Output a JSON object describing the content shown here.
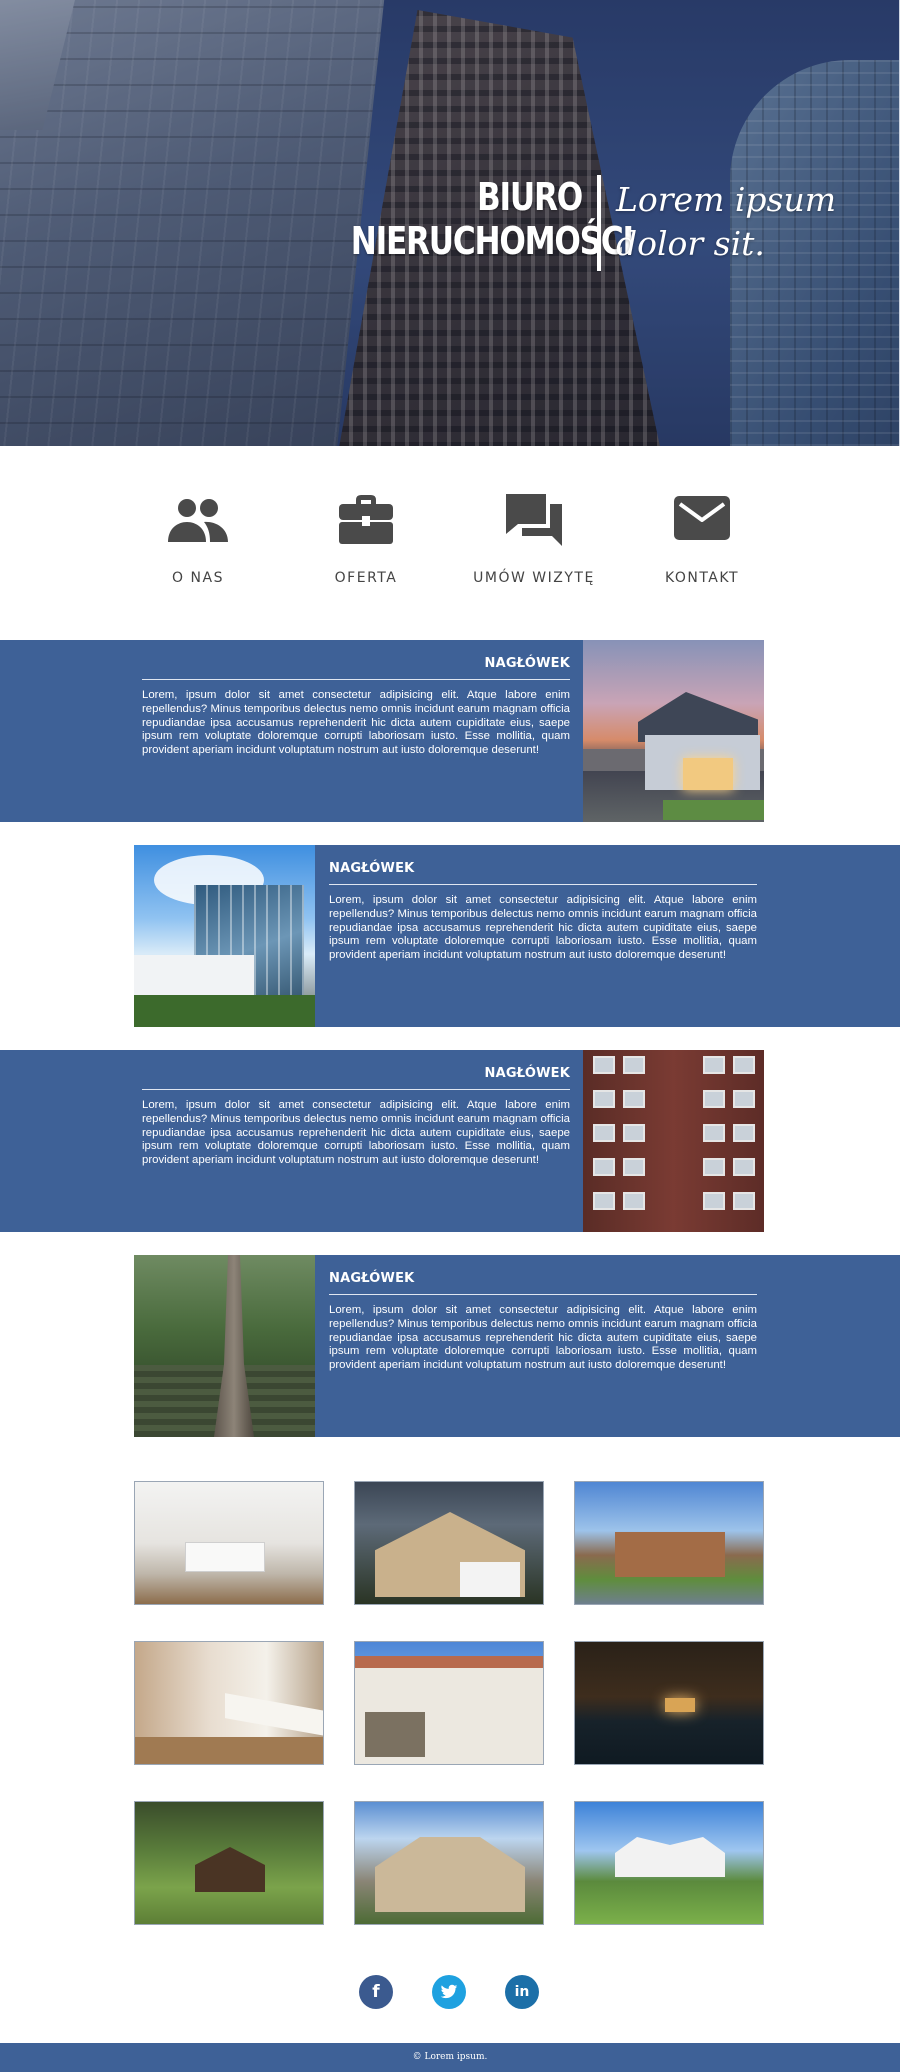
{
  "hero": {
    "brand_line1": "BIURO",
    "brand_line2": "NIERUCHOMOŚCI",
    "tagline_line1": "Lorem ipsum",
    "tagline_line2": "dolor sit."
  },
  "nav": {
    "items": [
      {
        "label": "O NAS",
        "icon": "people-icon"
      },
      {
        "label": "OFERTA",
        "icon": "briefcase-icon"
      },
      {
        "label": "UMÓW WIZYTĘ",
        "icon": "chat-icon"
      },
      {
        "label": "KONTAKT",
        "icon": "mail-icon"
      }
    ]
  },
  "cards": [
    {
      "title": "NAGŁÓWEK",
      "body": "Lorem, ipsum dolor sit amet consectetur adipisicing elit. Atque labore enim repellendus? Minus temporibus delectus nemo omnis incidunt earum magnam officia repudiandae ipsa accusamus reprehenderit hic dicta autem cupiditate eius, saepe ipsum rem voluptate doloremque corrupti laboriosam iusto. Esse mollitia, quam provident aperiam incidunt voluptatum nostrum aut iusto doloremque deserunt!"
    },
    {
      "title": "NAGŁÓWEK",
      "body": "Lorem, ipsum dolor sit amet consectetur adipisicing elit. Atque labore enim repellendus? Minus temporibus delectus nemo omnis incidunt earum magnam officia repudiandae ipsa accusamus reprehenderit hic dicta autem cupiditate eius, saepe ipsum rem voluptate doloremque corrupti laboriosam iusto. Esse mollitia, quam provident aperiam incidunt voluptatum nostrum aut iusto doloremque deserunt!"
    },
    {
      "title": "NAGŁÓWEK",
      "body": "Lorem, ipsum dolor sit amet consectetur adipisicing elit. Atque labore enim repellendus? Minus temporibus delectus nemo omnis incidunt earum magnam officia repudiandae ipsa accusamus reprehenderit hic dicta autem cupiditate eius, saepe ipsum rem voluptate doloremque corrupti laboriosam iusto. Esse mollitia, quam provident aperiam incidunt voluptatum nostrum aut iusto doloremque deserunt!"
    },
    {
      "title": "NAGŁÓWEK",
      "body": "Lorem, ipsum dolor sit amet consectetur adipisicing elit. Atque labore enim repellendus? Minus temporibus delectus nemo omnis incidunt earum magnam officia repudiandae ipsa accusamus reprehenderit hic dicta autem cupiditate eius, saepe ipsum rem voluptate doloremque corrupti laboriosam iusto. Esse mollitia, quam provident aperiam incidunt voluptatum nostrum aut iusto doloremque deserunt!"
    }
  ],
  "social": {
    "facebook": "f",
    "twitter": "t",
    "linkedin": "in"
  },
  "footer": {
    "text": "© Lorem ipsum."
  },
  "colors": {
    "accent": "#3e6197",
    "icon": "#4a4a4a",
    "facebook": "#3b5a8f",
    "twitter": "#1ea1e0",
    "linkedin": "#1c6fa8"
  }
}
